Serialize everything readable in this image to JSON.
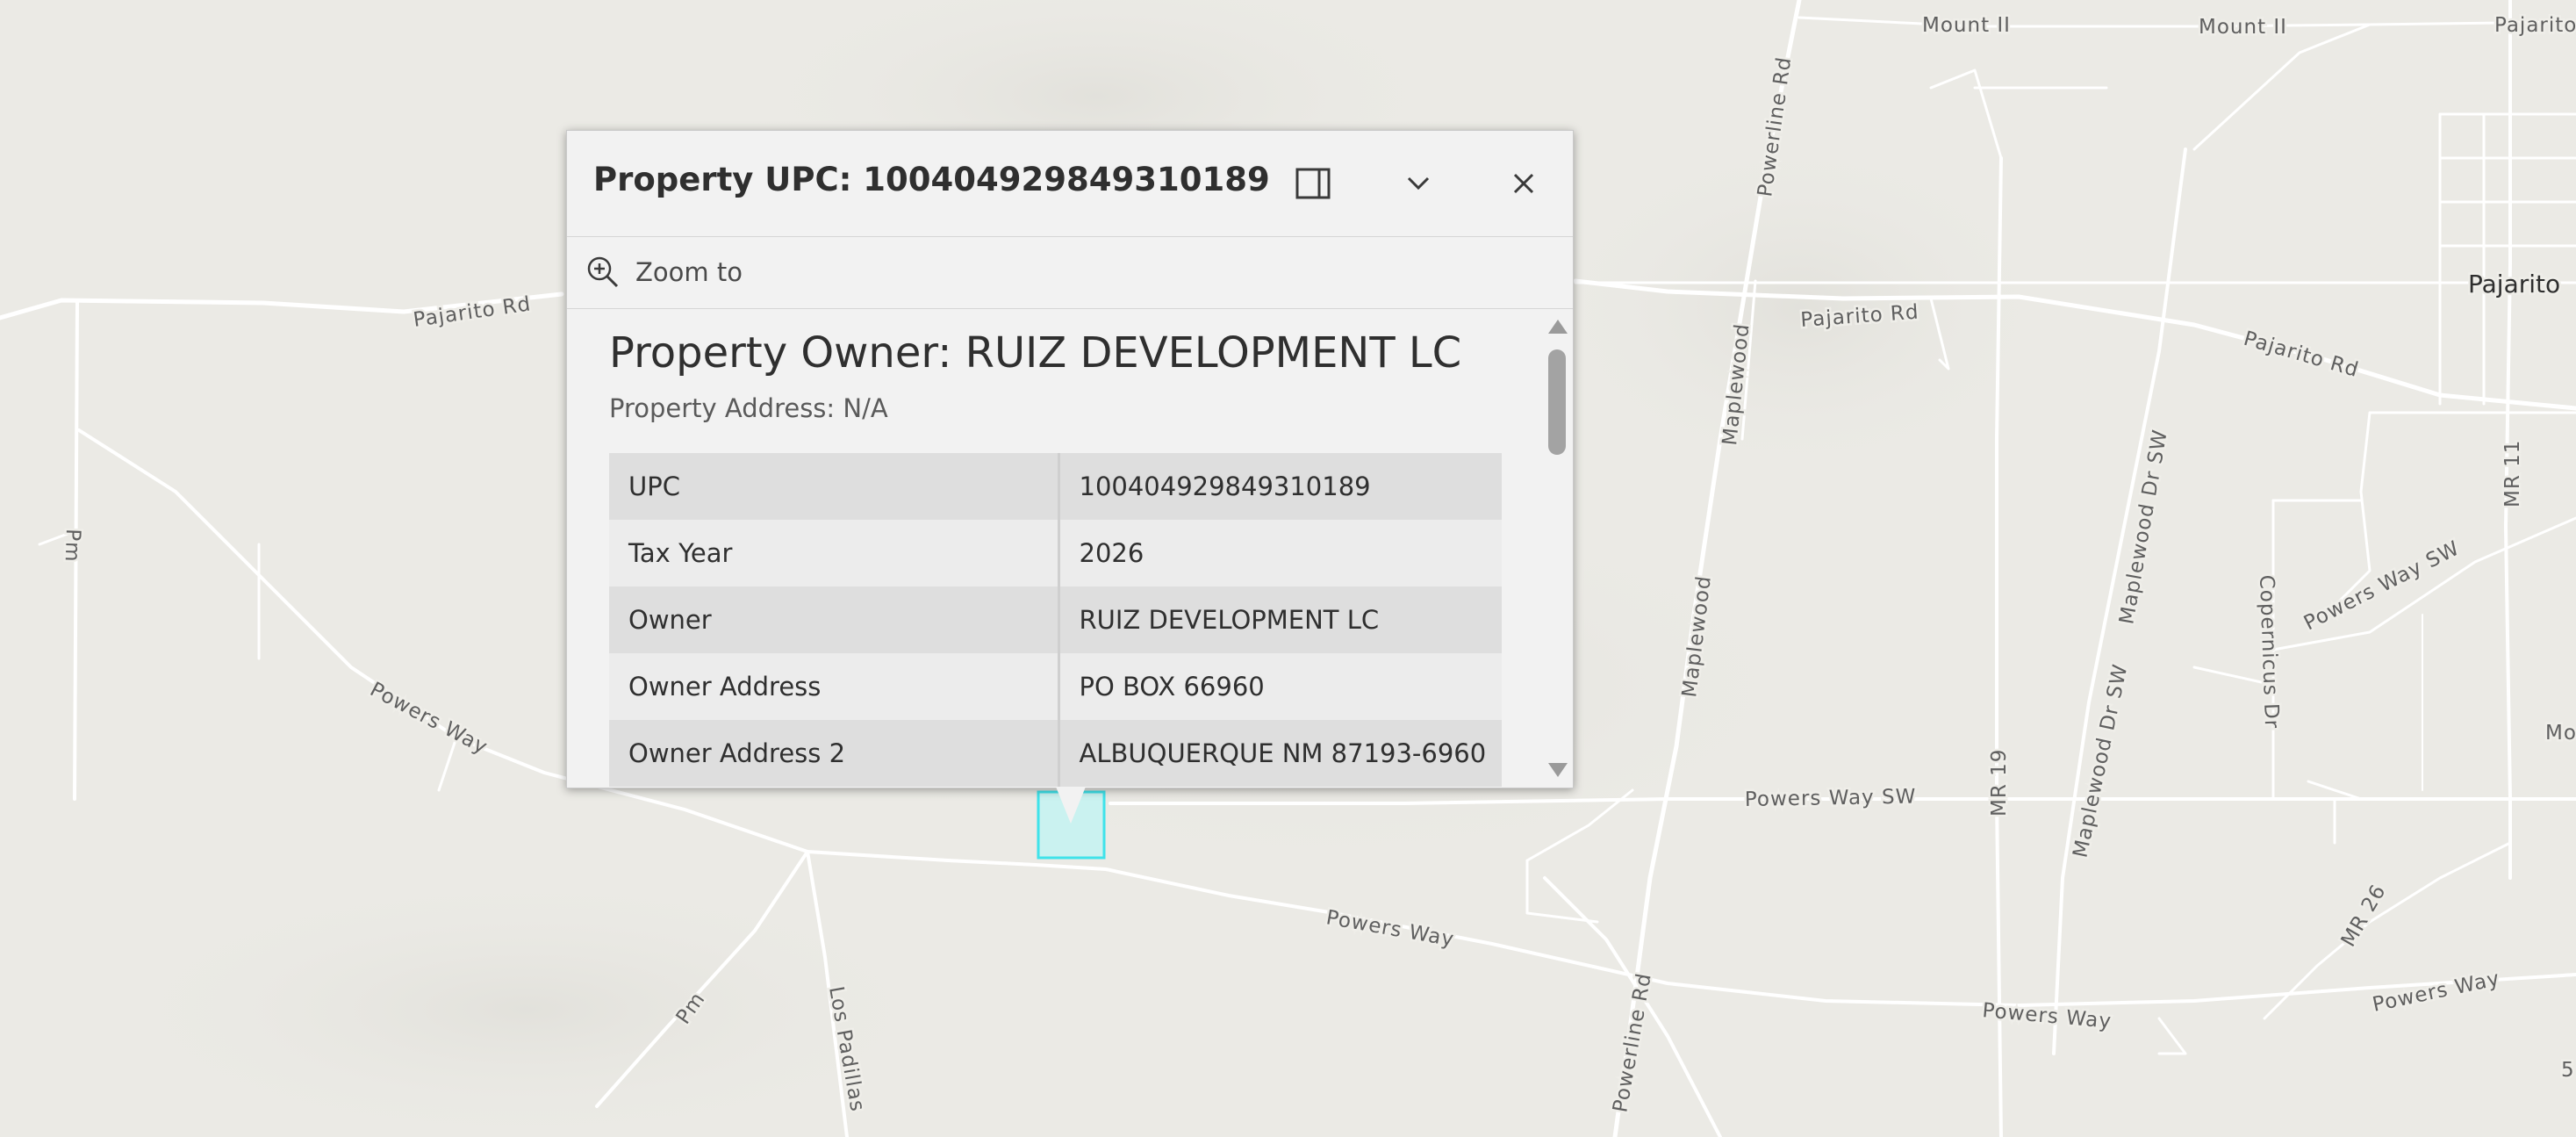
{
  "map": {
    "road_labels": [
      "Mount II",
      "Mount II",
      "Pajarito",
      "Powerline Rd",
      "Pajarito Rd",
      "Pajarito Rd",
      "Pajarito Rd",
      "Maplewood",
      "Maplewood Dr SW",
      "MR 11",
      "Powers Way SW",
      "Copernicus Dr",
      "Maplewood",
      "Maplewood Dr SW",
      "MR 19",
      "Powers Way SW",
      "Mou",
      "Pm",
      "Powers Way",
      "Powers Way",
      "MR 26",
      "Powers Way",
      "Powers Way",
      "Powerline Rd",
      "Pm",
      "Los Padillas",
      "5"
    ],
    "place_label": "Pajarito",
    "highlight_color": "#3fe3ea"
  },
  "popup": {
    "title": "Property UPC: 100404929849310189",
    "buttons": {
      "dock_icon": "dock-panel-icon",
      "collapse_icon": "chevron-down-icon",
      "close_icon": "close-icon"
    },
    "zoom_label": "Zoom to",
    "owner_heading": "Property Owner: RUIZ DEVELOPMENT LC",
    "address_line": "Property Address: N/A",
    "attributes": [
      {
        "key": "UPC",
        "value": "100404929849310189"
      },
      {
        "key": "Tax Year",
        "value": "2026"
      },
      {
        "key": "Owner",
        "value": "RUIZ DEVELOPMENT LC"
      },
      {
        "key": "Owner Address",
        "value": "PO BOX 66960"
      },
      {
        "key": "Owner Address 2",
        "value": "ALBUQUERQUE NM 87193-6960"
      }
    ]
  }
}
